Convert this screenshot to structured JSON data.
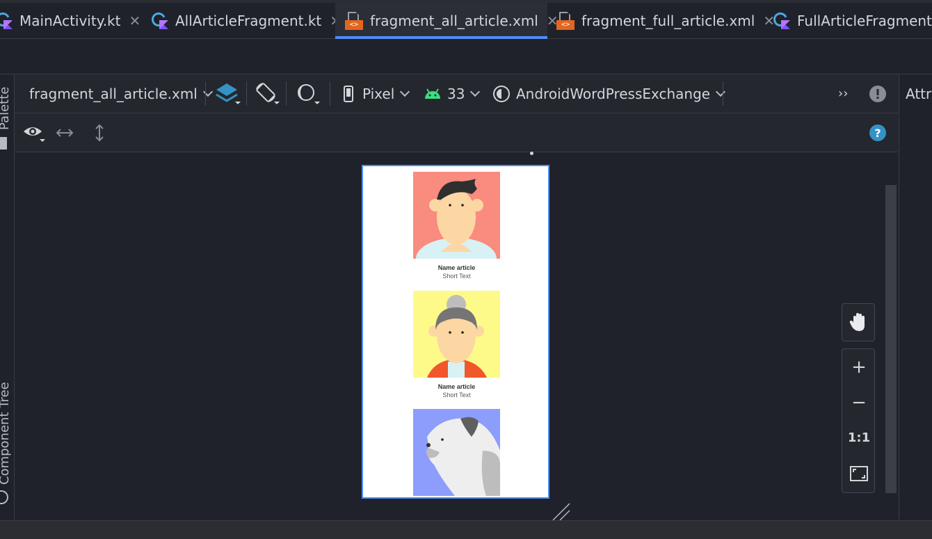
{
  "tabs": [
    {
      "label": "MainActivity.kt",
      "icon": "kotlin-file-icon",
      "active": false
    },
    {
      "label": "AllArticleFragment.kt",
      "icon": "kotlin-file-icon",
      "active": false
    },
    {
      "label": "fragment_all_article.xml",
      "icon": "xml-file-icon",
      "active": true
    },
    {
      "label": "fragment_full_article.xml",
      "icon": "xml-file-icon",
      "active": false
    },
    {
      "label": "FullArticleFragment.kt",
      "icon": "kotlin-file-icon",
      "active": false
    }
  ],
  "left_panel": {
    "palette": "Palette",
    "component_tree": "Component Tree"
  },
  "right_panel": {
    "attributes": "Attri"
  },
  "toolbar": {
    "file": "fragment_all_article.xml",
    "device": "Pixel",
    "api": "33",
    "theme": "AndroidWordPressExchange",
    "more": "››"
  },
  "preview": {
    "items": [
      {
        "name": "Name article",
        "short": "Short Text",
        "bg": "#f98b7f"
      },
      {
        "name": "Name article",
        "short": "Short Text",
        "bg": "#fdfa8a"
      },
      {
        "bg": "#8c9dfc"
      }
    ]
  },
  "zoom": {
    "one_to_one": "1:1"
  },
  "colors": {
    "accent": "#4d8ef8",
    "help": "#3592c4",
    "android_green": "#3ddc84"
  }
}
